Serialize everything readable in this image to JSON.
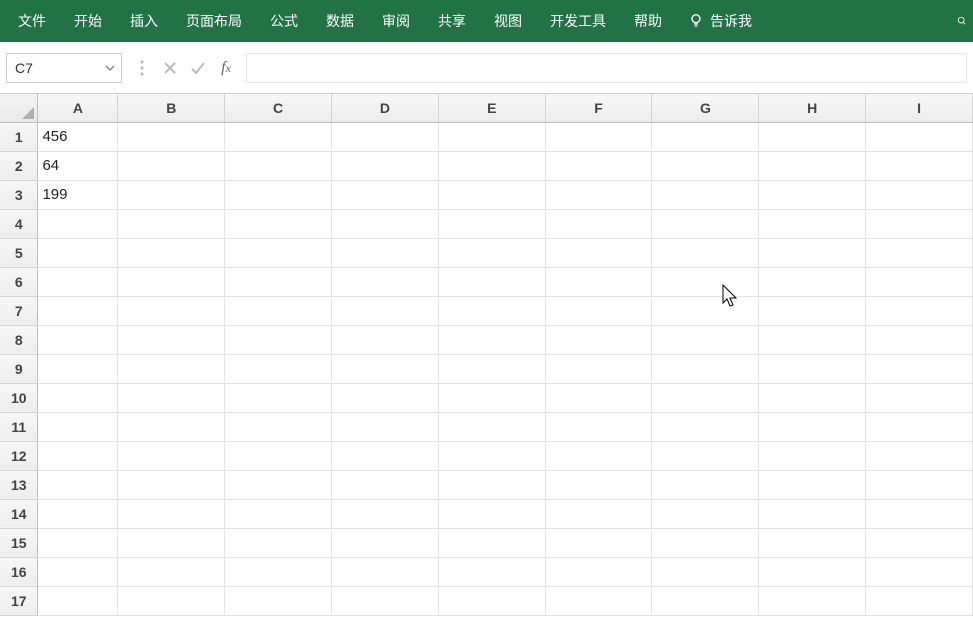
{
  "ribbon": {
    "tabs": [
      "文件",
      "开始",
      "插入",
      "页面布局",
      "公式",
      "数据",
      "审阅",
      "共享",
      "视图",
      "开发工具",
      "帮助"
    ],
    "tell": "告诉我"
  },
  "formula_bar": {
    "namebox": "C7",
    "formula": ""
  },
  "grid": {
    "columns": [
      "A",
      "B",
      "C",
      "D",
      "E",
      "F",
      "G",
      "H",
      "I"
    ],
    "rows": [
      "1",
      "2",
      "3",
      "4",
      "5",
      "6",
      "7",
      "8",
      "9",
      "10",
      "11",
      "12",
      "13",
      "14",
      "15",
      "16",
      "17"
    ],
    "cells": {
      "A1": "456",
      "A2": "64",
      "A3": "199"
    }
  }
}
